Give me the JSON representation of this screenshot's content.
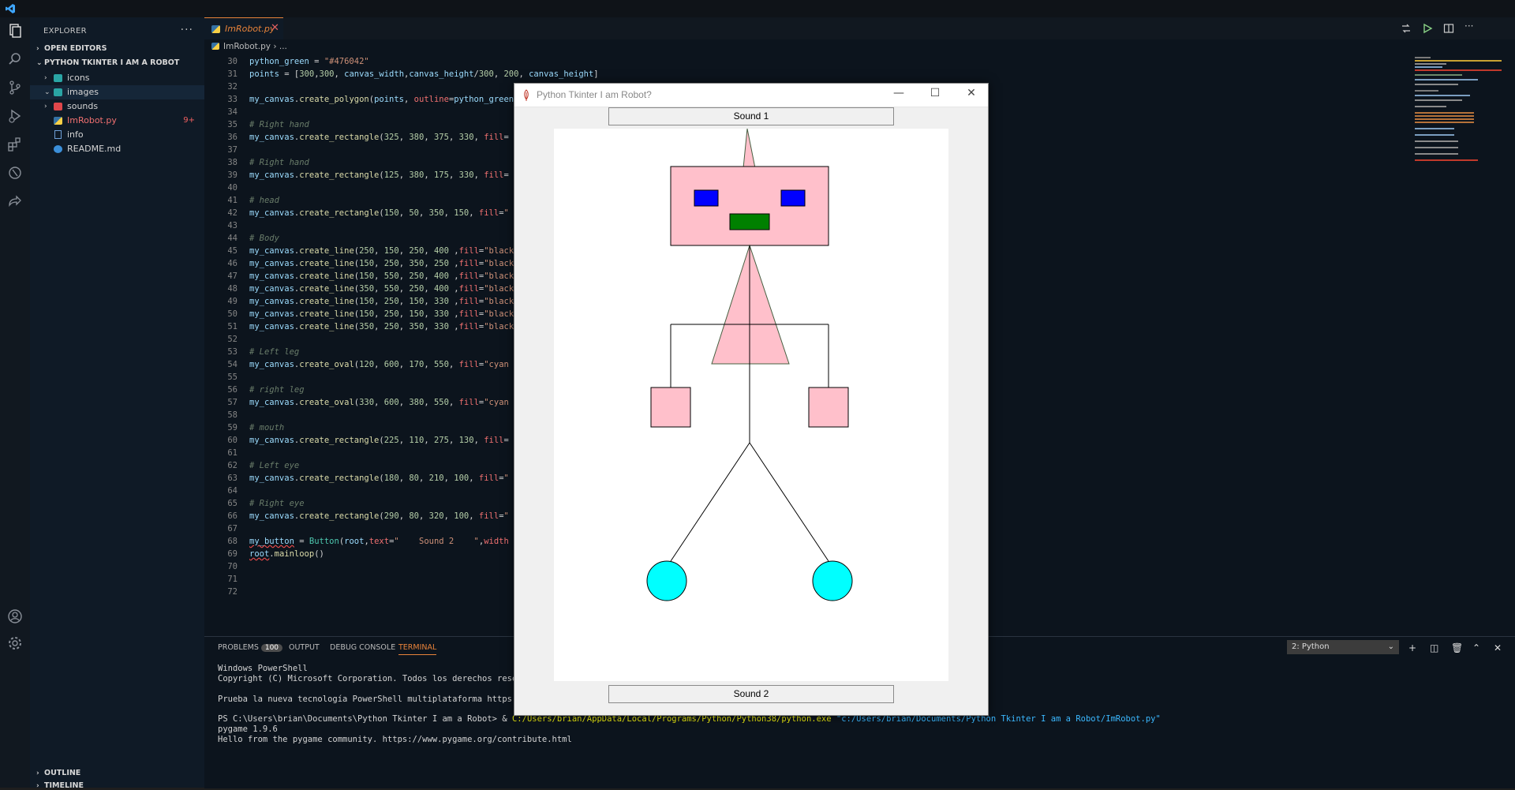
{
  "sidebar": {
    "title": "EXPLORER",
    "more": "···",
    "open_editors": "OPEN EDITORS",
    "folder": "PYTHON TKINTER I AM A ROBOT",
    "items": [
      {
        "label": "icons",
        "chevron": "›",
        "icon": "folder-icon",
        "color": "#2aa5a5"
      },
      {
        "label": "images",
        "chevron": "⌄",
        "icon": "folder-icon",
        "color": "#2aa5a5"
      },
      {
        "label": "sounds",
        "chevron": "›",
        "icon": "folder-icon",
        "color": "#e0474b"
      },
      {
        "label": "ImRobot.py",
        "chevron": "",
        "icon": "python-icon",
        "color": "#3572a5",
        "badge": "9+"
      },
      {
        "label": "info",
        "chevron": "",
        "icon": "file-icon",
        "color": "#6fa0d8"
      },
      {
        "label": "README.md",
        "chevron": "",
        "icon": "info-icon",
        "color": "#3b8fd9"
      }
    ],
    "outline": "OUTLINE",
    "timeline": "TIMELINE"
  },
  "editor": {
    "tab": {
      "label": "ImRobot.py",
      "close": "✕"
    },
    "breadcrumb": "ImRobot.py › ...",
    "line_numbers": [
      "30",
      "31",
      "32",
      "33",
      "34",
      "35",
      "36",
      "37",
      "38",
      "39",
      "40",
      "41",
      "42",
      "43",
      "44",
      "45",
      "46",
      "47",
      "48",
      "49",
      "50",
      "51",
      "52",
      "53",
      "54",
      "55",
      "56",
      "57",
      "58",
      "59",
      "60",
      "61",
      "62",
      "63",
      "64",
      "65",
      "66",
      "67",
      "68",
      "69",
      "70",
      "71",
      "72"
    ]
  },
  "panel": {
    "tabs": {
      "problems": "PROBLEMS",
      "problems_count": "100",
      "output": "OUTPUT",
      "debug": "DEBUG CONSOLE",
      "terminal": "TERMINAL"
    },
    "terminal_select": "2: Python",
    "terminal_lines": {
      "l1": "Windows PowerShell",
      "l2": "Copyright (C) Microsoft Corporation. Todos los derechos reserva",
      "l3": "Prueba la nueva tecnología PowerShell multiplataforma https://a",
      "l4_prompt": "PS C:\\Users\\brian\\Documents\\Python Tkinter I am a Robot> & ",
      "l4_exe": "C:/Users/brian/AppData/Local/Programs/Python/Python38/python.exe",
      "l4_arg": " \"c:/Users/brian/Documents/Python Tkinter I am a Robot/ImRobot.py\"",
      "l5": "pygame 1.9.6",
      "l6": "Hello from the pygame community. https://www.pygame.org/contribute.html"
    }
  },
  "tk_window": {
    "title": "Python Tkinter I am Robot?",
    "minimize": "—",
    "maximize": "☐",
    "close": "✕",
    "button1": "Sound 1",
    "button2": "Sound 2",
    "colors": {
      "pink": "#ffc0cb",
      "blue": "#0000ff",
      "green": "#008000",
      "cyan": "#00ffff"
    }
  }
}
